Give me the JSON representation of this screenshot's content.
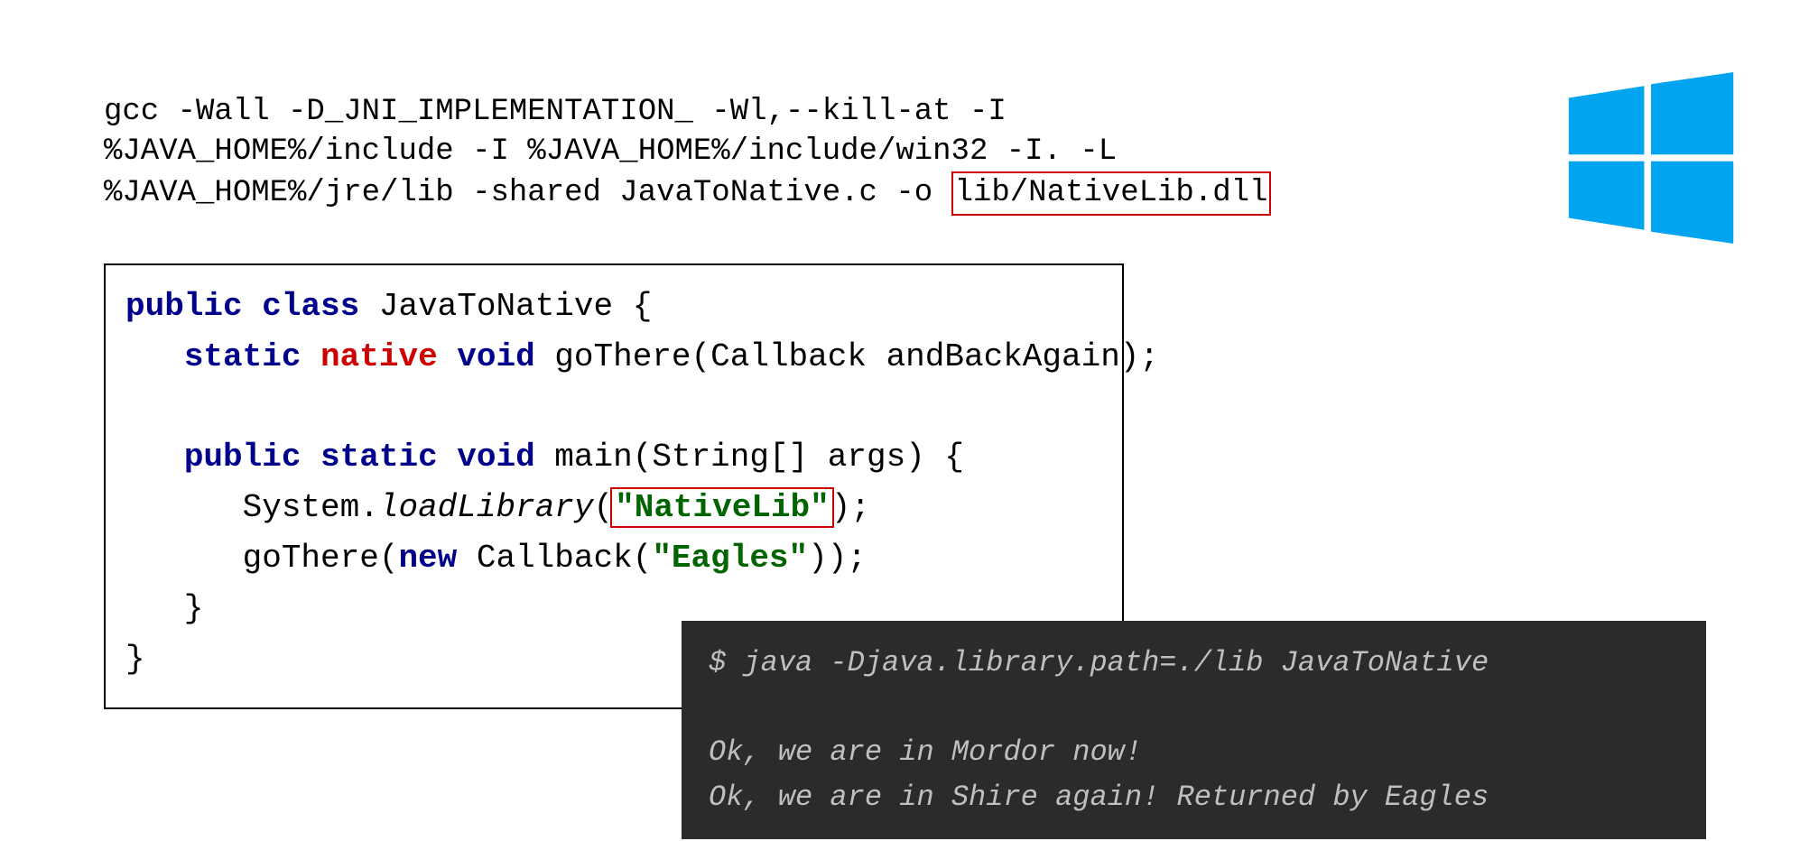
{
  "gcc": {
    "line1": "gcc -Wall -D_JNI_IMPLEMENTATION_ -Wl,--kill-at -I",
    "line2": "%JAVA_HOME%/include -I %JAVA_HOME%/include/win32 -I. -L",
    "line3_pre": "%JAVA_HOME%/jre/lib -shared JavaToNative.c -o ",
    "line3_box": "lib/NativeLib.dll"
  },
  "java": {
    "l1_kw_public": "public",
    "l1_kw_class": "class",
    "l1_rest": " JavaToNative {",
    "l2_indent": "   ",
    "l2_kw_static": "static",
    "l2_kw_native": "native",
    "l2_kw_void": "void",
    "l2_rest": " goThere(Callback andBackAgain);",
    "blank": "",
    "l4_indent": "   ",
    "l4_kw_public": "public",
    "l4_kw_static": "static",
    "l4_kw_void": "void",
    "l4_rest": " main(String[] args) {",
    "l5_pre": "      System.",
    "l5_method": "loadLibrary",
    "l5_paren": "(",
    "l5_str": "\"NativeLib\"",
    "l5_post": ");",
    "l6_pre": "      goThere(",
    "l6_kw_new": "new",
    "l6_mid": " Callback(",
    "l6_str": "\"Eagles\"",
    "l6_post": "));",
    "l7": "   }",
    "l8": "}"
  },
  "terminal": {
    "line1": "$ java -Djava.library.path=./lib JavaToNative",
    "blank": "",
    "line3": "Ok, we are in Mordor now!",
    "line4": "Ok, we are in Shire again! Returned by Eagles"
  },
  "logo": {
    "color": "#00A4EF"
  }
}
